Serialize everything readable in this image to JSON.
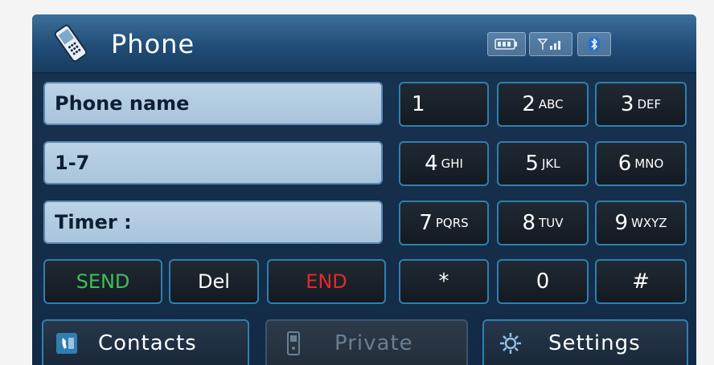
{
  "titlebar": {
    "title": "Phone",
    "icons": [
      "battery-icon",
      "signal-icon",
      "bluetooth-icon"
    ]
  },
  "fields": {
    "phone_name": "Phone name",
    "number": "1-7",
    "timer": "Timer :"
  },
  "keypad": [
    {
      "num": "1",
      "letters": ""
    },
    {
      "num": "2",
      "letters": "ABC"
    },
    {
      "num": "3",
      "letters": "DEF"
    },
    {
      "num": "4",
      "letters": "GHI"
    },
    {
      "num": "5",
      "letters": "JKL"
    },
    {
      "num": "6",
      "letters": "MNO"
    },
    {
      "num": "7",
      "letters": "PQRS"
    },
    {
      "num": "8",
      "letters": "TUV"
    },
    {
      "num": "9",
      "letters": "WXYZ"
    },
    {
      "num": "*",
      "letters": ""
    },
    {
      "num": "0",
      "letters": ""
    },
    {
      "num": "#",
      "letters": ""
    }
  ],
  "controls": {
    "send": "SEND",
    "del": "Del",
    "end": "END"
  },
  "bottom": {
    "contacts": "Contacts",
    "private": "Private",
    "settings": "Settings"
  },
  "colors": {
    "send": "#3fbf5a",
    "end": "#e02b2b",
    "accent": "#2f7fb0"
  }
}
